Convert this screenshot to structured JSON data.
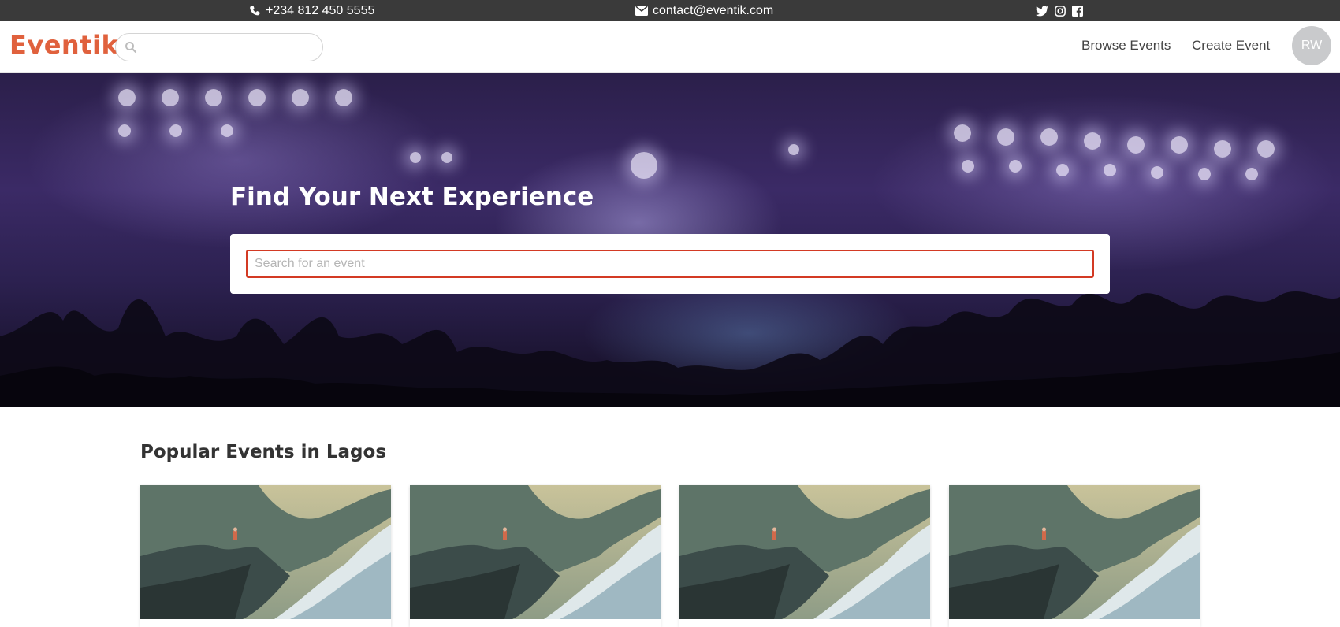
{
  "topbar": {
    "phone": "+234 812 450 5555",
    "email": "contact@eventik.com",
    "social_icons": [
      "twitter-icon",
      "instagram-icon",
      "facebook-icon"
    ]
  },
  "navbar": {
    "logo": "Eventik",
    "search_placeholder": "",
    "links": [
      "Browse Events",
      "Create Event"
    ],
    "avatar_initials": "RW"
  },
  "hero": {
    "title": "Find Your Next Experience",
    "search_placeholder": "Search for an event"
  },
  "popular": {
    "title": "Popular Events in Lagos",
    "cards": [
      {
        "image": "cliff-lake-image"
      },
      {
        "image": "cliff-lake-image"
      },
      {
        "image": "cliff-lake-image"
      },
      {
        "image": "cliff-lake-image"
      }
    ]
  },
  "colors": {
    "brand": "#e0613d",
    "topbar": "#3a3a3a",
    "input_border": "#d33a24"
  }
}
